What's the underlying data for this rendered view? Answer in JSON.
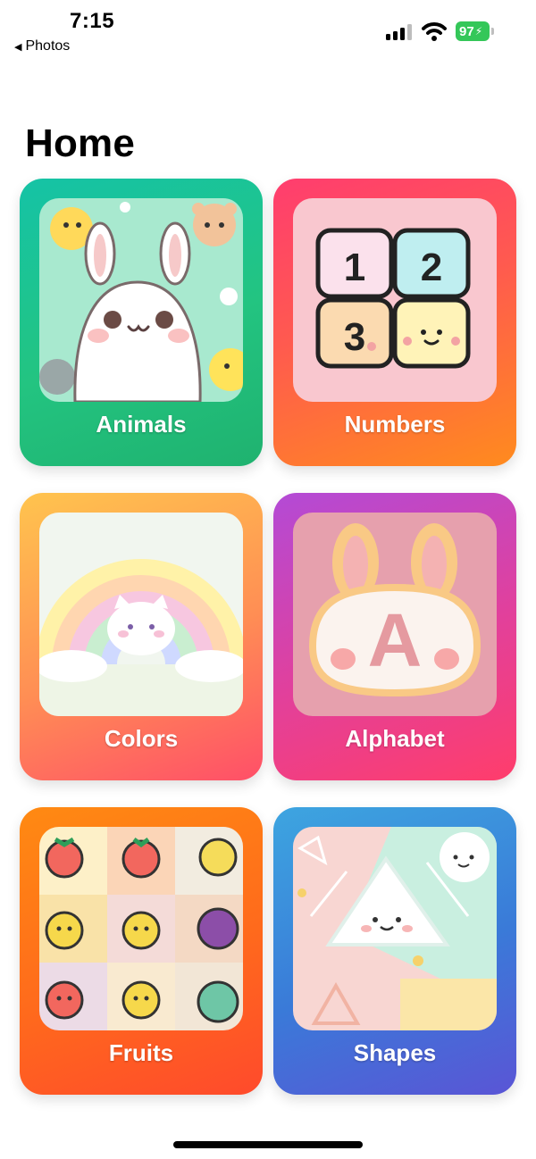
{
  "status_bar": {
    "time": "7:15",
    "back_label": "Photos",
    "battery": "97"
  },
  "page": {
    "title": "Home"
  },
  "categories": [
    {
      "label": "Animals"
    },
    {
      "label": "Numbers"
    },
    {
      "label": "Colors"
    },
    {
      "label": "Alphabet"
    },
    {
      "label": "Fruits"
    },
    {
      "label": "Shapes"
    }
  ],
  "art": {
    "numbers_tiles": [
      "1",
      "2",
      "3"
    ],
    "alphabet_letter": "A"
  },
  "colors": {
    "battery_green": "#34c759",
    "animals_card": "#1fc08f",
    "numbers_card": "#ff5a4f",
    "colors_card": "#ff8e54",
    "alphabet_card": "#d9438f",
    "fruits_card": "#ff6a1c",
    "shapes_card": "#3a7ad8"
  }
}
